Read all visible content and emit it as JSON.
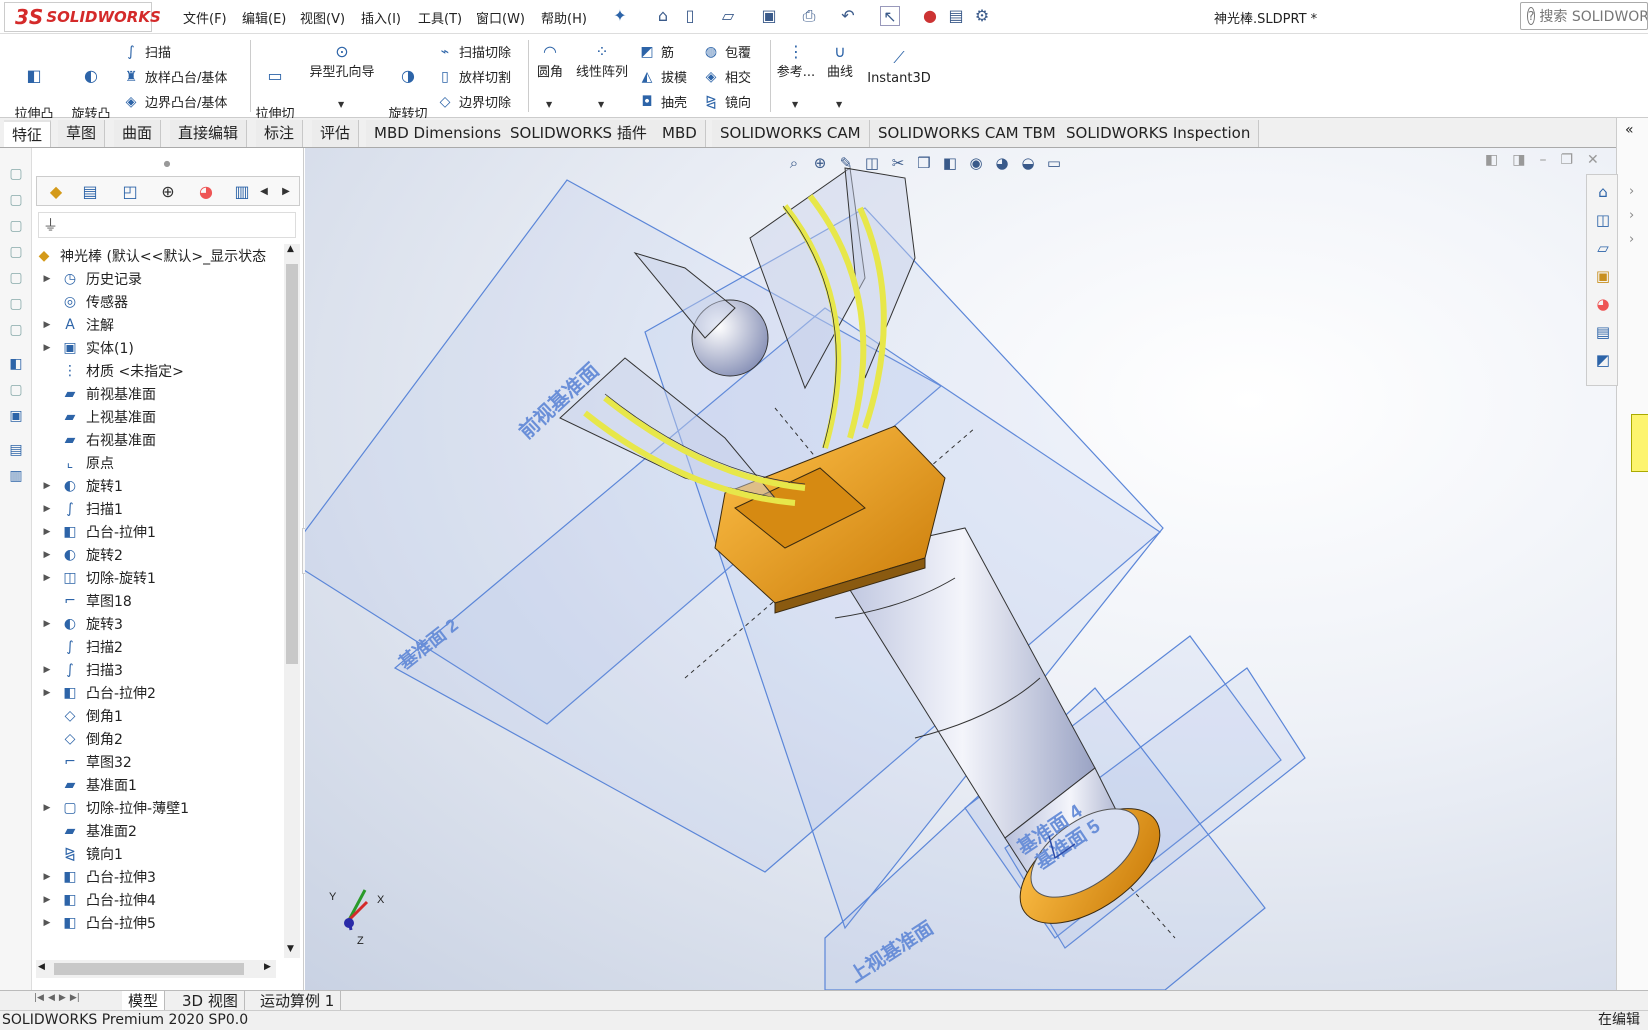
{
  "app": {
    "logo_prefix": "3S",
    "logo_name": "SOLIDWORKS"
  },
  "menu": [
    "文件(F)",
    "编辑(E)",
    "视图(V)",
    "插入(I)",
    "工具(T)",
    "窗口(W)",
    "帮助(H)"
  ],
  "document_title": "神光棒.SLDPRT *",
  "search": {
    "placeholder": "搜索 SOLIDWORKS"
  },
  "ribbon": {
    "extrude_boss": "拉伸凸\n台/基体",
    "revolve_boss": "旋转凸\n台/基体",
    "sweep": "扫描",
    "loft_boss": "放样凸台/基体",
    "boundary_boss": "边界凸台/基体",
    "extrude_cut": "拉伸切\n除",
    "hole_wizard": "异型孔向导",
    "revolve_cut": "旋转切\n除",
    "swept_cut": "扫描切除",
    "lofted_cut": "放样切割",
    "boundary_cut": "边界切除",
    "fillet": "圆角",
    "linear_pattern": "线性阵列",
    "rib": "筋",
    "wrap": "包覆",
    "draft": "拔模",
    "intersect": "相交",
    "shell": "抽壳",
    "mirror": "镜向",
    "reference": "参考...",
    "curves": "曲线",
    "instant3d": "Instant3D"
  },
  "command_tabs": [
    "特征",
    "草图",
    "曲面",
    "直接编辑",
    "标注",
    "评估",
    "MBD Dimensions",
    "SOLIDWORKS 插件",
    "MBD",
    "SOLIDWORKS CAM",
    "SOLIDWORKS CAM TBM",
    "SOLIDWORKS Inspection"
  ],
  "tree": {
    "root": "神光棒 (默认<<默认>_显示状态",
    "items": [
      {
        "label": "历史记录",
        "expand": true,
        "icon": "history-icon"
      },
      {
        "label": "传感器",
        "expand": false,
        "icon": "sensor-icon"
      },
      {
        "label": "注解",
        "expand": true,
        "icon": "annotation-icon"
      },
      {
        "label": "实体(1)",
        "expand": true,
        "icon": "solid-body-icon"
      },
      {
        "label": "材质 <未指定>",
        "expand": false,
        "icon": "material-icon"
      },
      {
        "label": "前视基准面",
        "expand": false,
        "icon": "plane-icon"
      },
      {
        "label": "上视基准面",
        "expand": false,
        "icon": "plane-icon"
      },
      {
        "label": "右视基准面",
        "expand": false,
        "icon": "plane-icon"
      },
      {
        "label": "原点",
        "expand": false,
        "icon": "origin-icon"
      },
      {
        "label": "旋转1",
        "expand": true,
        "icon": "revolve-icon"
      },
      {
        "label": "扫描1",
        "expand": true,
        "icon": "sweep-icon"
      },
      {
        "label": "凸台-拉伸1",
        "expand": true,
        "icon": "extrude-icon"
      },
      {
        "label": "旋转2",
        "expand": true,
        "icon": "revolve-icon"
      },
      {
        "label": "切除-旋转1",
        "expand": true,
        "icon": "cut-revolve-icon"
      },
      {
        "label": "草图18",
        "expand": false,
        "icon": "sketch-icon"
      },
      {
        "label": "旋转3",
        "expand": true,
        "icon": "revolve-icon"
      },
      {
        "label": "扫描2",
        "expand": false,
        "icon": "sweep-icon"
      },
      {
        "label": "扫描3",
        "expand": true,
        "icon": "sweep-icon"
      },
      {
        "label": "凸台-拉伸2",
        "expand": true,
        "icon": "extrude-icon"
      },
      {
        "label": "倒角1",
        "expand": false,
        "icon": "chamfer-icon"
      },
      {
        "label": "倒角2",
        "expand": false,
        "icon": "chamfer-icon"
      },
      {
        "label": "草图32",
        "expand": false,
        "icon": "sketch-icon"
      },
      {
        "label": "基准面1",
        "expand": false,
        "icon": "plane-icon"
      },
      {
        "label": "切除-拉伸-薄壁1",
        "expand": true,
        "icon": "cut-extrude-icon"
      },
      {
        "label": "基准面2",
        "expand": false,
        "icon": "plane-icon"
      },
      {
        "label": "镜向1",
        "expand": false,
        "icon": "mirror-icon"
      },
      {
        "label": "凸台-拉伸3",
        "expand": true,
        "icon": "extrude-icon"
      },
      {
        "label": "凸台-拉伸4",
        "expand": true,
        "icon": "extrude-icon"
      },
      {
        "label": "凸台-拉伸5",
        "expand": true,
        "icon": "extrude-icon"
      }
    ]
  },
  "viewport_labels": {
    "front_plane": "前视基准面",
    "plane2": "基准面 2",
    "top_plane": "上视基准面",
    "plane4": "基准面 4",
    "plane5": "基准面 5",
    "axis_x": "X",
    "axis_y": "Y",
    "axis_z": "Z"
  },
  "bottom_tabs": [
    "模型",
    "3D 视图",
    "运动算例 1"
  ],
  "status": {
    "left": "SOLIDWORKS Premium 2020 SP0.0",
    "right": "在编辑"
  },
  "colors": {
    "accent": "#2d64a8",
    "plane": "#5b86d8",
    "gold": "#f0a21c",
    "yellow_stripe": "#e7e74a",
    "logo_red": "#d42a2a"
  }
}
